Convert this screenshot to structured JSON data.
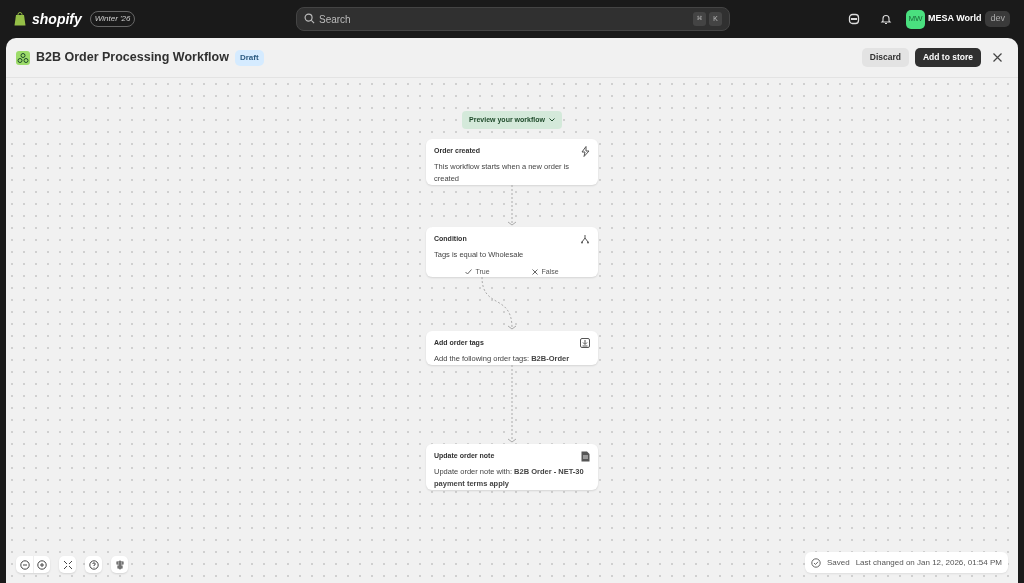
{
  "topbar": {
    "logo_text": "shopify",
    "edition": "Winter '26",
    "search": {
      "placeholder": "Search",
      "shortcut": [
        "⌘",
        "K"
      ]
    },
    "account": {
      "initials": "MW",
      "name": "MESA World",
      "badge": "dev"
    }
  },
  "header": {
    "title": "B2B Order Processing Workflow",
    "status": "Draft",
    "buttons": [
      {
        "label": "Discard",
        "kind": "secondary"
      },
      {
        "label": "Add to store",
        "kind": "primary"
      }
    ]
  },
  "preview_button": "Preview your workflow",
  "nodes": [
    {
      "kind": "trigger",
      "title": "Order created",
      "description": "This workflow starts when a new order is created"
    },
    {
      "kind": "condition",
      "title": "Condition",
      "description": "Tags is equal to Wholesale",
      "branches": [
        {
          "kind": "true",
          "label": "True"
        },
        {
          "kind": "false",
          "label": "False"
        }
      ]
    },
    {
      "kind": "tag_action",
      "title": "Add order tags",
      "description": "Add the following order tags: **B2B-Order**"
    },
    {
      "kind": "note_action",
      "title": "Update order note",
      "description": "Update order note with: **B2B Order - NET-30 payment terms apply**"
    }
  ],
  "status_bar": {
    "state": "Saved",
    "last_changed": "Last changed on Jan 12, 2026, 01:54 PM"
  }
}
